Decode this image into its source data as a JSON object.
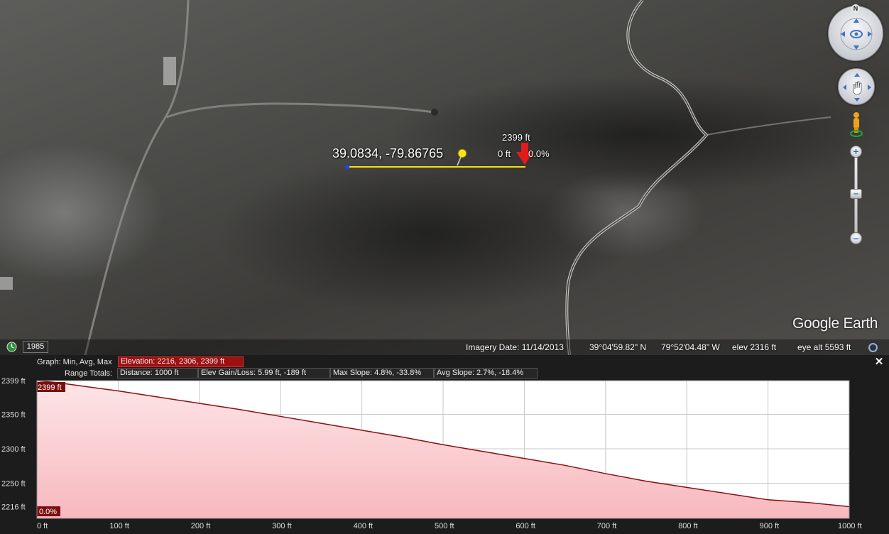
{
  "map": {
    "pin_coords": "39.0834, -79.86765",
    "point_elevation": "2399 ft",
    "point_distance": "0 ft",
    "point_slope": "0.0%",
    "logo": "Google Earth",
    "year_badge": "1985",
    "north": "N",
    "icons": [
      "history-clock-icon",
      "look-joystick-icon",
      "move-hand-icon",
      "pegman-icon",
      "zoom-in-icon",
      "zoom-out-icon",
      "refresh-icon",
      "yellow-pushpin-icon",
      "red-arrow-marker-icon"
    ]
  },
  "status": {
    "imagery_date": "Imagery Date: 11/14/2013",
    "lat": "39°04'59.82\" N",
    "lon": "79°52'04.48\" W",
    "elev": "elev  2316 ft",
    "eye_alt": "eye alt   5593 ft"
  },
  "profile": {
    "graph_label": "Graph: Min, Avg, Max",
    "elevation_stats": "Elevation: 2216, 2306, 2399 ft",
    "range_totals_label": "Range Totals:",
    "distance": "Distance: 1000 ft",
    "gain_loss": "Elev Gain/Loss: 5.99 ft, -189 ft",
    "max_slope": "Max Slope: 4.8%, -33.8%",
    "avg_slope": "Avg Slope: 2.7%, -18.4%",
    "close": "✕",
    "cursor_elev_tag": "2399 ft",
    "cursor_slope_tag": "0.0%"
  },
  "chart_data": {
    "type": "area",
    "x_unit": "ft",
    "y_unit": "ft",
    "xlim": [
      0,
      1000
    ],
    "ylim": [
      2199,
      2399
    ],
    "x_ticks": [
      "0 ft",
      "100 ft",
      "200 ft",
      "300 ft",
      "400 ft",
      "500 ft",
      "600 ft",
      "700 ft",
      "800 ft",
      "900 ft",
      "1000 ft"
    ],
    "y_ticks": [
      {
        "value": 2399,
        "label": "2399 ft"
      },
      {
        "value": 2350,
        "label": "2350 ft"
      },
      {
        "value": 2300,
        "label": "2300 ft"
      },
      {
        "value": 2250,
        "label": "2250 ft"
      },
      {
        "value": 2216,
        "label": "2216 ft"
      }
    ],
    "series": [
      {
        "x": [
          0,
          25,
          50,
          100,
          150,
          200,
          250,
          300,
          350,
          400,
          450,
          500,
          550,
          600,
          650,
          700,
          750,
          800,
          850,
          900,
          950,
          1000
        ],
        "values": [
          2399,
          2396,
          2392,
          2384,
          2375,
          2366,
          2357,
          2347,
          2337,
          2327,
          2317,
          2306,
          2296,
          2286,
          2276,
          2264,
          2253,
          2244,
          2235,
          2226,
          2222,
          2216
        ]
      }
    ],
    "grid": true,
    "fill_color": "#f7b8be",
    "line_color": "#8a1010"
  }
}
